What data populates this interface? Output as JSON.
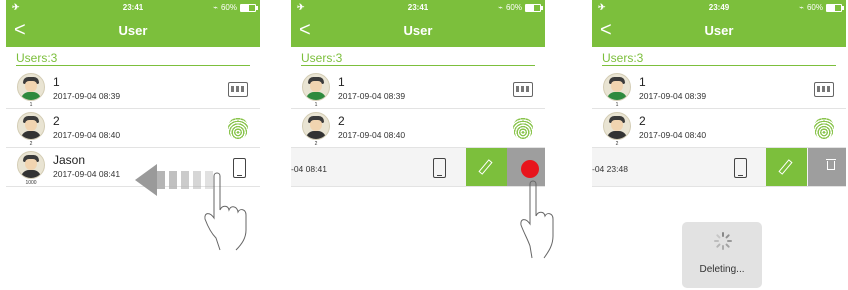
{
  "screens": [
    {
      "status": {
        "time": "23:41",
        "battery": "60%"
      },
      "nav": {
        "title": "User",
        "back": "<"
      },
      "users_label": "Users:3",
      "rows": [
        {
          "name": "1",
          "date": "2017-09-04 08:39",
          "avatar_num": "1",
          "icon": "keypad-icon"
        },
        {
          "name": "2",
          "date": "2017-09-04 08:40",
          "avatar_num": "2",
          "icon": "fingerprint-icon"
        },
        {
          "name": "Jason",
          "date": "2017-09-04 08:41",
          "avatar_num": "1000",
          "icon": "phone-icon"
        }
      ]
    },
    {
      "status": {
        "time": "23:41",
        "battery": "60%"
      },
      "nav": {
        "title": "User",
        "back": "<"
      },
      "users_label": "Users:3",
      "rows": [
        {
          "name": "1",
          "date": "2017-09-04 08:39",
          "avatar_num": "1",
          "icon": "keypad-icon"
        },
        {
          "name": "2",
          "date": "2017-09-04 08:40",
          "avatar_num": "2",
          "icon": "fingerprint-icon"
        }
      ],
      "swiped_row": {
        "date_fragment": "-04 08:41"
      }
    },
    {
      "status": {
        "time": "23:49",
        "battery": "60%"
      },
      "nav": {
        "title": "User",
        "back": "<"
      },
      "users_label": "Users:3",
      "rows": [
        {
          "name": "1",
          "date": "2017-09-04 08:39",
          "avatar_num": "1",
          "icon": "keypad-icon"
        },
        {
          "name": "2",
          "date": "2017-09-04 08:40",
          "avatar_num": "2",
          "icon": "fingerprint-icon"
        }
      ],
      "swiped_row": {
        "date_fragment": "-04 23:48"
      },
      "toast": {
        "text": "Deleting..."
      }
    }
  ],
  "colors": {
    "brand_green": "#7cbf3c",
    "delete_gray": "#9e9e9e",
    "tap_red": "#e8141c"
  }
}
